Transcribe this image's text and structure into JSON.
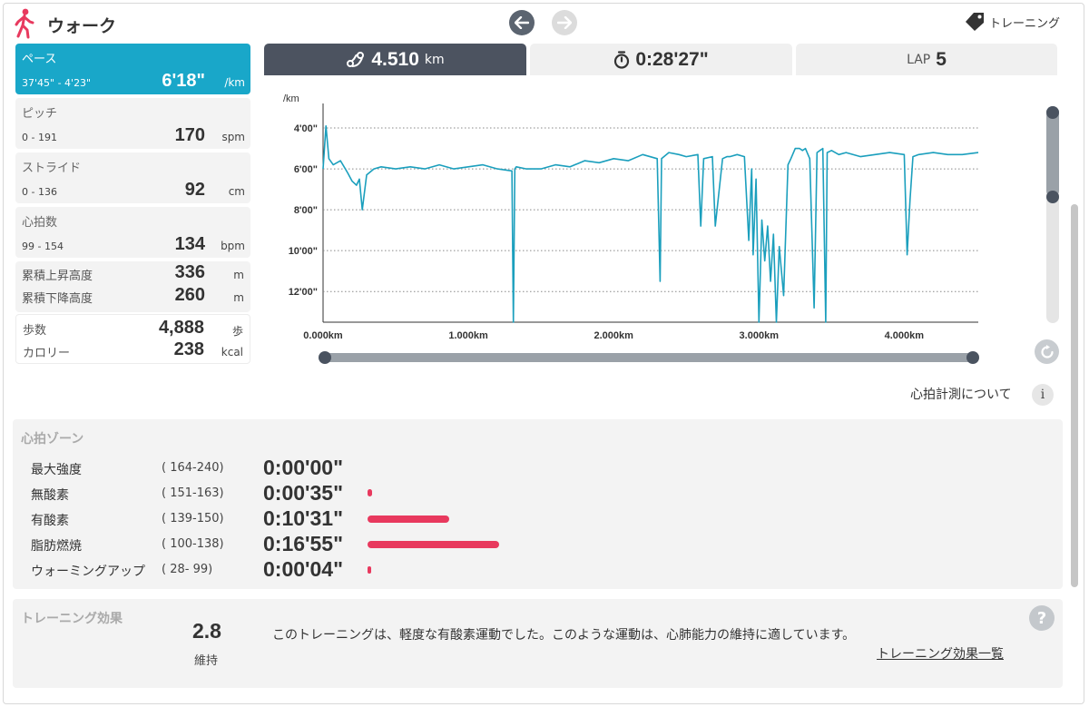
{
  "header": {
    "title": "ウォーク",
    "training_label": "トレーニング"
  },
  "stats": {
    "pace": {
      "label": "ペース",
      "range": "37'45\" - 4'23\"",
      "value": "6'18\"",
      "unit": "/km"
    },
    "pitch": {
      "label": "ピッチ",
      "range": "0 - 191",
      "value": "170",
      "unit": "spm"
    },
    "stride": {
      "label": "ストライド",
      "range": "0 - 136",
      "value": "92",
      "unit": "cm"
    },
    "heart_rate": {
      "label": "心拍数",
      "range": "99 - 154",
      "value": "134",
      "unit": "bpm"
    },
    "elevation": {
      "ascent_label": "累積上昇高度",
      "ascent_value": "336",
      "ascent_unit": "m",
      "descent_label": "累積下降高度",
      "descent_value": "260",
      "descent_unit": "m"
    },
    "steps": {
      "steps_label": "歩数",
      "steps_value": "4,888",
      "steps_unit": "歩",
      "calorie_label": "カロリー",
      "calorie_value": "238",
      "calorie_unit": "kcal"
    }
  },
  "tabs": {
    "distance": {
      "value": "4.510",
      "unit": "km"
    },
    "duration": {
      "value": "0:28'27\""
    },
    "lap": {
      "label": "LAP",
      "value": "5"
    }
  },
  "chart_data": {
    "type": "line",
    "ylabel": "/km",
    "y_reversed": true,
    "ylim_minutes": [
      2.8,
      13.5
    ],
    "xlim_km": [
      0,
      4.51
    ],
    "y_ticks": [
      "4'00\"",
      "6'00\"",
      "8'00\"",
      "10'00\"",
      "12'00\""
    ],
    "x_ticks": [
      "0.000km",
      "1.000km",
      "2.000km",
      "3.000km",
      "4.000km"
    ],
    "grid": "dotted",
    "series": [
      {
        "color": "#1b9fbd",
        "x": [
          0.0,
          0.02,
          0.04,
          0.07,
          0.12,
          0.17,
          0.2,
          0.23,
          0.25,
          0.27,
          0.3,
          0.35,
          0.4,
          0.5,
          0.6,
          0.7,
          0.8,
          0.9,
          1.0,
          1.1,
          1.2,
          1.3,
          1.31,
          1.32,
          1.33,
          1.4,
          1.5,
          1.6,
          1.7,
          1.8,
          1.9,
          2.0,
          2.1,
          2.2,
          2.3,
          2.32,
          2.33,
          2.38,
          2.45,
          2.5,
          2.58,
          2.6,
          2.62,
          2.68,
          2.7,
          2.75,
          2.78,
          2.8,
          2.85,
          2.9,
          2.93,
          2.95,
          2.96,
          2.98,
          3.0,
          3.02,
          3.04,
          3.06,
          3.08,
          3.1,
          3.12,
          3.14,
          3.17,
          3.2,
          3.22,
          3.25,
          3.28,
          3.3,
          3.32,
          3.35,
          3.38,
          3.4,
          3.42,
          3.44,
          3.46,
          3.47,
          3.5,
          3.55,
          3.6,
          3.7,
          3.8,
          3.9,
          4.0,
          4.02,
          4.04,
          4.06,
          4.1,
          4.2,
          4.3,
          4.4,
          4.51
        ],
        "y": [
          6.0,
          3.9,
          5.5,
          5.8,
          5.6,
          6.2,
          6.6,
          6.8,
          6.5,
          8.0,
          6.3,
          6.0,
          5.9,
          6.0,
          5.9,
          6.0,
          5.8,
          6.0,
          5.9,
          5.8,
          6.0,
          6.1,
          13.5,
          6.0,
          5.9,
          6.0,
          6.0,
          5.8,
          5.9,
          5.6,
          5.7,
          5.5,
          5.6,
          5.3,
          5.5,
          11.5,
          5.5,
          5.2,
          5.3,
          5.4,
          5.3,
          8.8,
          5.5,
          5.4,
          8.8,
          5.5,
          5.4,
          5.4,
          5.3,
          5.4,
          9.5,
          6.0,
          10.2,
          6.5,
          13.5,
          8.5,
          10.5,
          8.8,
          11.5,
          9.2,
          13.5,
          9.8,
          12.2,
          5.8,
          5.5,
          5.0,
          5.0,
          5.1,
          5.0,
          5.5,
          12.8,
          5.2,
          5.1,
          5.0,
          13.5,
          5.2,
          5.1,
          5.3,
          5.2,
          5.4,
          5.3,
          5.2,
          5.3,
          10.2,
          7.5,
          5.4,
          5.3,
          5.2,
          5.3,
          5.3,
          5.2
        ]
      }
    ]
  },
  "hr_about": "心拍計測について",
  "hr_zone": {
    "title": "心拍ゾーン",
    "bar_color": "#e8395e",
    "zones": [
      {
        "name": "最大強度",
        "range": "( 164-240)",
        "time": "0:00'00\"",
        "fraction": 0.0
      },
      {
        "name": "無酸素",
        "range": "( 151-163)",
        "time": "0:00'35\"",
        "fraction": 0.035
      },
      {
        "name": "有酸素",
        "range": "( 139-150)",
        "time": "0:10'31\"",
        "fraction": 0.62
      },
      {
        "name": "脂肪燃焼",
        "range": "( 100-138)",
        "time": "0:16'55\"",
        "fraction": 1.0
      },
      {
        "name": "ウォーミングアップ",
        "range": "(  28-  99)",
        "time": "0:00'04\"",
        "fraction": 0.004
      }
    ]
  },
  "training_effect": {
    "title": "トレーニング効果",
    "value": "2.8",
    "level": "維持",
    "description": "このトレーニングは、軽度な有酸素運動でした。このような運動は、心肺能力の維持に適しています。",
    "link": "トレーニング効果一覧"
  }
}
